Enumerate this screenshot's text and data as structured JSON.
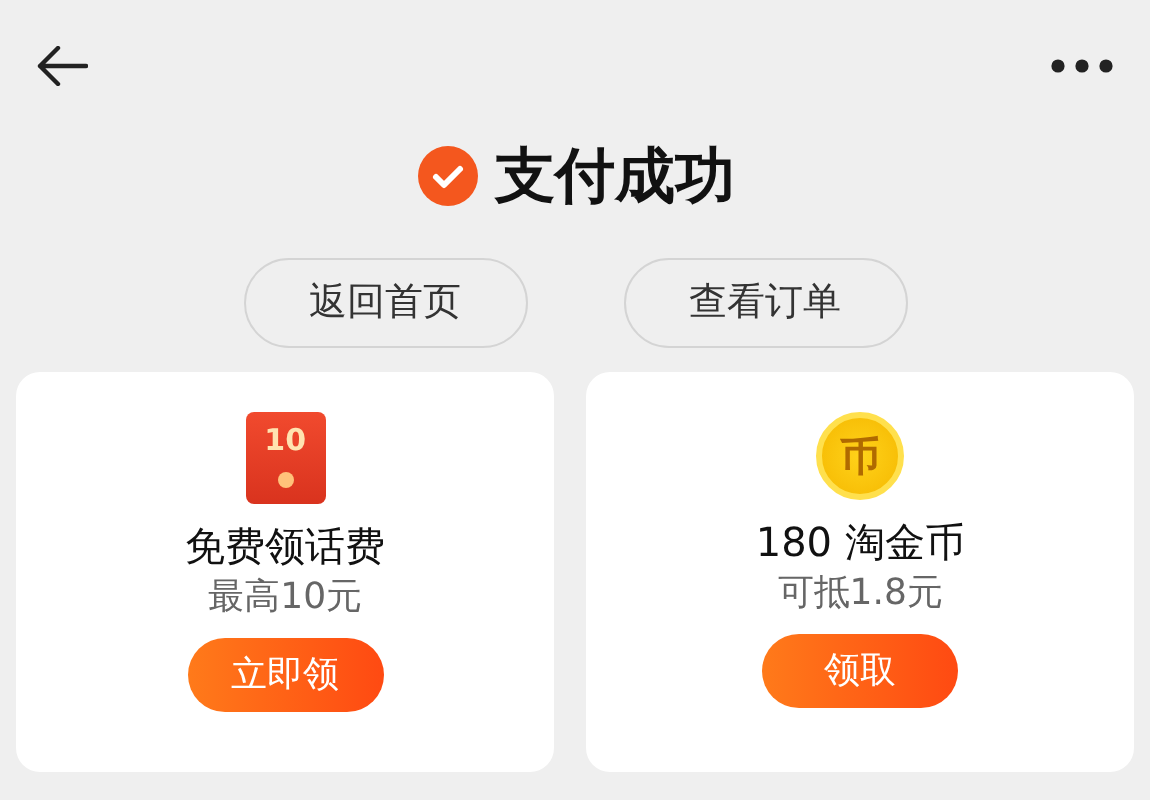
{
  "header": {
    "title": "支付成功"
  },
  "actions": [
    {
      "label": "返回首页"
    },
    {
      "label": "查看订单"
    }
  ],
  "rewards": [
    {
      "kind": "red-packet",
      "icon_text": "10",
      "title": "免费领话费",
      "subtitle": "最高10元",
      "button": "立即领"
    },
    {
      "kind": "coin",
      "icon_text": "币",
      "title": "180 淘金币",
      "subtitle": "可抵1.8元",
      "button": "领取"
    }
  ]
}
